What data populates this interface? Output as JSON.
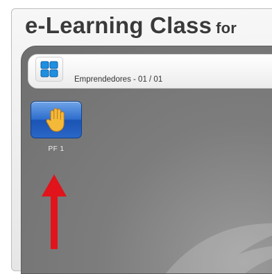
{
  "header": {
    "title": "e-Learning Class",
    "title_suffix": "for"
  },
  "toolbar": {
    "grid_button_icon": "grid-layout-icon",
    "session_label": "Emprendedores - 01 / 01"
  },
  "students": [
    {
      "label": "PF 1",
      "icon": "raised-hand-icon",
      "status": "hand-raised"
    }
  ],
  "annotation": {
    "icon": "red-arrow-up-icon",
    "color": "#e0141a"
  },
  "colors": {
    "tile_blue": "#2f6fce",
    "hand": "#f5b93a",
    "panel_gray": "#7d7d7d"
  }
}
